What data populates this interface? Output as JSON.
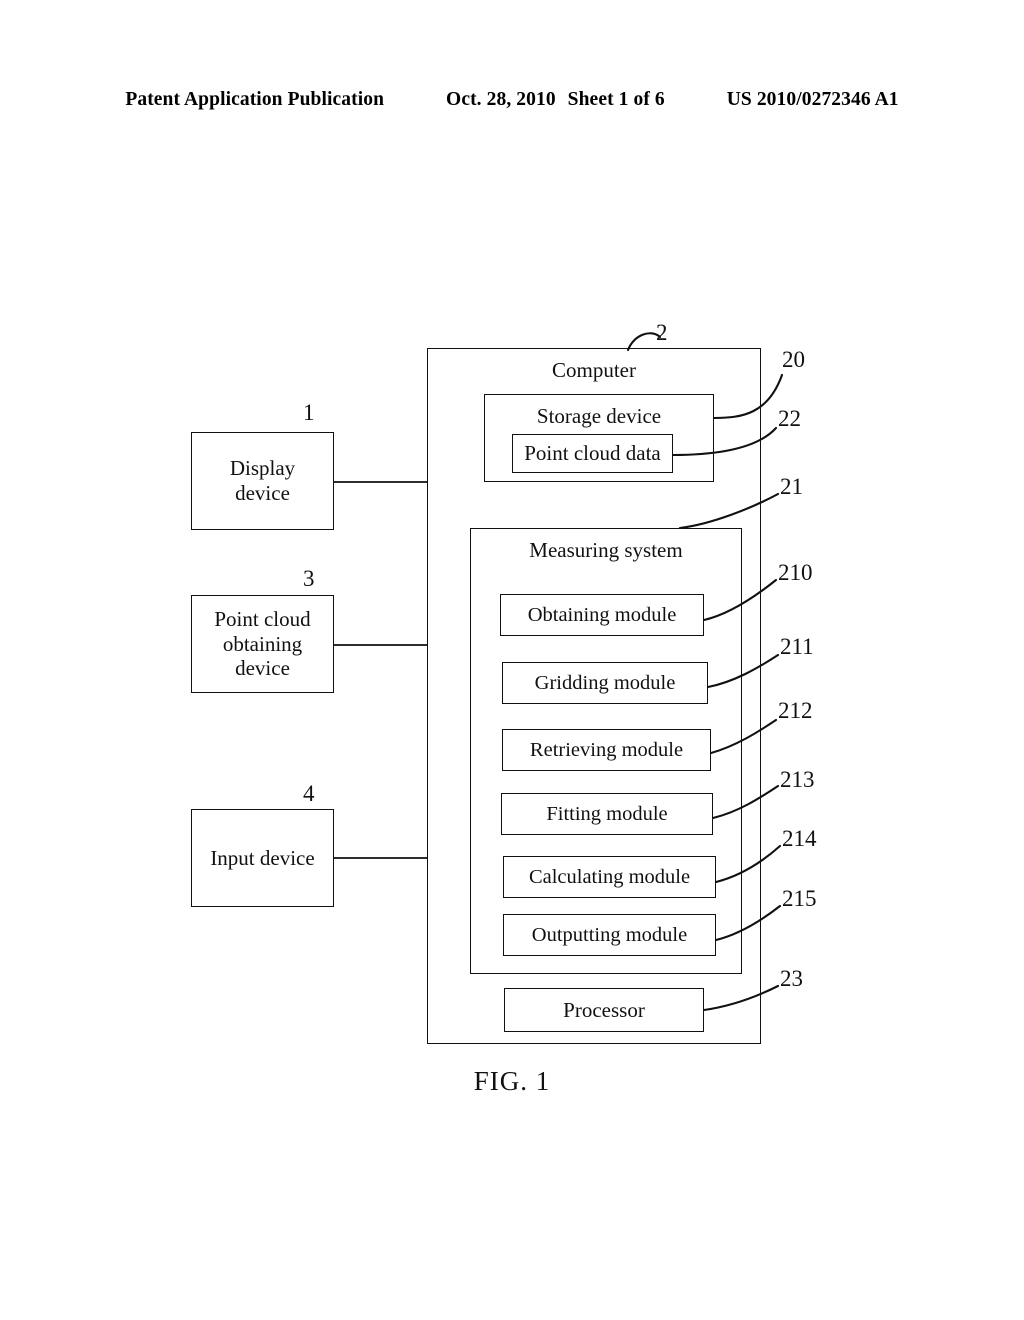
{
  "header": {
    "publication": "Patent Application Publication",
    "date": "Oct. 28, 2010",
    "sheet": "Sheet 1 of 6",
    "patent_number": "US 2010/0272346 A1"
  },
  "figure": {
    "caption": "FIG. 1"
  },
  "diagram": {
    "peripherals": [
      {
        "id": "display-device",
        "label": "Display\ndevice",
        "ref": "1"
      },
      {
        "id": "point-cloud-obtaining-device",
        "label": "Point cloud\nobtaining\ndevice",
        "ref": "3"
      },
      {
        "id": "input-device",
        "label": "Input device",
        "ref": "4"
      }
    ],
    "computer": {
      "label": "Computer",
      "ref": "2",
      "storage_device": {
        "label": "Storage device",
        "ref": "20",
        "point_cloud_data": {
          "label": "Point cloud data",
          "ref": "22"
        }
      },
      "measuring_system": {
        "label": "Measuring system",
        "ref": "21",
        "modules": [
          {
            "id": "obtaining-module",
            "label": "Obtaining module",
            "ref": "210"
          },
          {
            "id": "gridding-module",
            "label": "Gridding module",
            "ref": "211"
          },
          {
            "id": "retrieving-module",
            "label": "Retrieving module",
            "ref": "212"
          },
          {
            "id": "fitting-module",
            "label": "Fitting module",
            "ref": "213"
          },
          {
            "id": "calculating-module",
            "label": "Calculating module",
            "ref": "214"
          },
          {
            "id": "outputting-module",
            "label": "Outputting  module",
            "ref": "215"
          }
        ]
      },
      "processor": {
        "label": "Processor",
        "ref": "23"
      }
    }
  }
}
